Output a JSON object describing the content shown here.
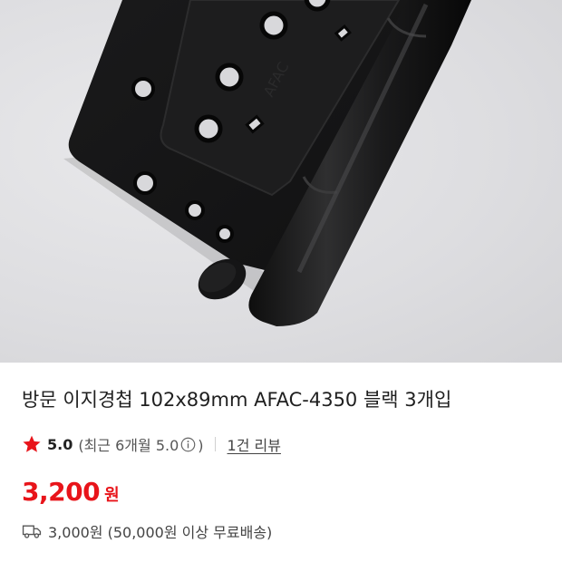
{
  "product": {
    "image_alt": "black door hinge product photo",
    "image_embossed_text": "AFAC",
    "title": "방문 이지경첩 102x89mm AFAC-4350 블랙 3개입"
  },
  "rating": {
    "star_icon": "star-icon",
    "star_color": "#e8141a",
    "score": "5.0",
    "recent_prefix": "(최근 6개월 5.0",
    "recent_suffix": ")",
    "info_icon": "info-icon",
    "review_link": "1건 리뷰"
  },
  "price": {
    "value": "3,200",
    "unit": "원",
    "color": "#e8141a"
  },
  "shipping": {
    "icon": "truck-icon",
    "text": "3,000원 (50,000원 이상 무료배송)"
  }
}
